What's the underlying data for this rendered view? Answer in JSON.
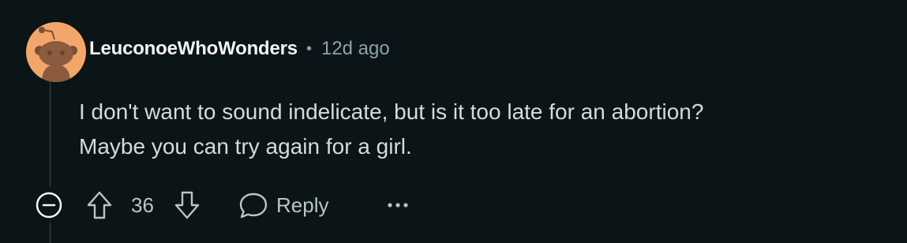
{
  "comment": {
    "author": "LeuconoeWhoWonders",
    "separator": "•",
    "timestamp": "12d ago",
    "body_lines": [
      "I don't want to sound indelicate, but is it too late for an abortion?",
      "Maybe you can try again for a girl."
    ]
  },
  "actions": {
    "score": "36",
    "reply_label": "Reply"
  },
  "icons": {
    "avatar": "snoo-avatar-icon",
    "collapse": "minus-circle-icon",
    "upvote": "upvote-arrow-icon",
    "downvote": "downvote-arrow-icon",
    "reply": "speech-bubble-icon",
    "more": "ellipsis-icon"
  },
  "colors": {
    "background": "#0b1416",
    "avatar_background": "#f3a66a",
    "username": "#f2f4f5",
    "body_text": "#d7dadc",
    "muted_text": "#8ba2ad",
    "thread_line": "#3e4a4e"
  }
}
